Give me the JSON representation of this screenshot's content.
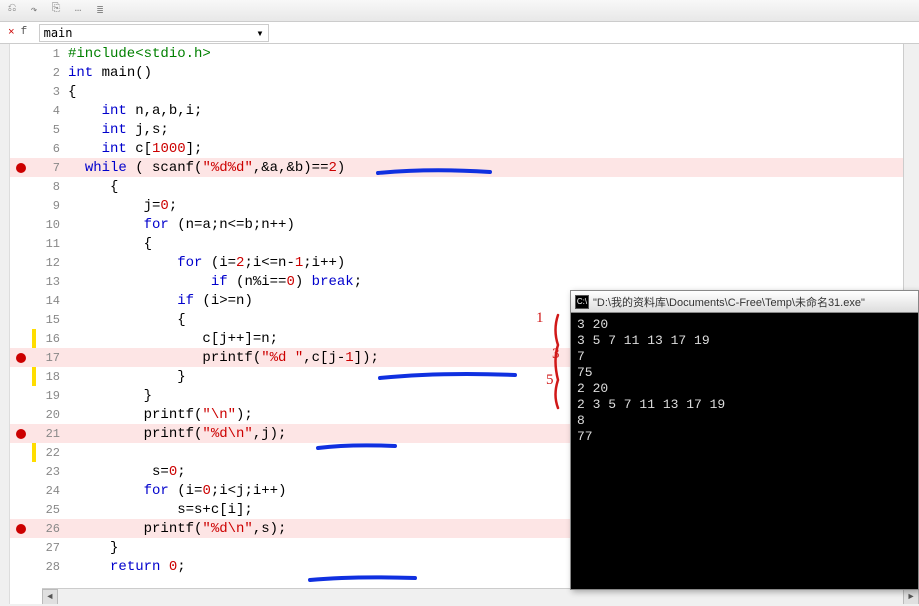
{
  "toolbar": {
    "icons": [
      "⎌",
      "↷",
      "⎘",
      "…",
      "≣"
    ]
  },
  "funcbar": {
    "icon": "f",
    "label": "main",
    "arrow": "▾"
  },
  "close_x": "×",
  "code": [
    {
      "n": 1,
      "bp": false,
      "hl": false,
      "mark": "",
      "html": "<span class='pp'>#include&lt;stdio.h&gt;</span>"
    },
    {
      "n": 2,
      "bp": false,
      "hl": false,
      "mark": "",
      "html": "<span class='type'>int</span> main()"
    },
    {
      "n": 3,
      "bp": false,
      "hl": false,
      "mark": "",
      "html": "{"
    },
    {
      "n": 4,
      "bp": false,
      "hl": false,
      "mark": "",
      "html": "    <span class='type'>int</span> n,a,b,i;"
    },
    {
      "n": 5,
      "bp": false,
      "hl": false,
      "mark": "",
      "html": "    <span class='type'>int</span> j,s;"
    },
    {
      "n": 6,
      "bp": false,
      "hl": false,
      "mark": "",
      "html": "    <span class='type'>int</span> c[<span class='num'>1000</span>];"
    },
    {
      "n": 7,
      "bp": true,
      "hl": true,
      "mark": "",
      "html": "  <span class='kw'>while</span> ( scanf(<span class='str'>\"%d%d\"</span>,&amp;a,&amp;b)==<span class='num'>2</span>)"
    },
    {
      "n": 8,
      "bp": false,
      "hl": false,
      "mark": "",
      "html": "     {"
    },
    {
      "n": 9,
      "bp": false,
      "hl": false,
      "mark": "",
      "html": "         j=<span class='num'>0</span>;"
    },
    {
      "n": 10,
      "bp": false,
      "hl": false,
      "mark": "",
      "html": "         <span class='kw'>for</span> (n=a;n&lt;=b;n++)"
    },
    {
      "n": 11,
      "bp": false,
      "hl": false,
      "mark": "",
      "html": "         {"
    },
    {
      "n": 12,
      "bp": false,
      "hl": false,
      "mark": "",
      "html": "             <span class='kw'>for</span> (i=<span class='num'>2</span>;i&lt;=n-<span class='num'>1</span>;i++)"
    },
    {
      "n": 13,
      "bp": false,
      "hl": false,
      "mark": "",
      "html": "                 <span class='kw'>if</span> (n%i==<span class='num'>0</span>) <span class='kw'>break</span>;"
    },
    {
      "n": 14,
      "bp": false,
      "hl": false,
      "mark": "",
      "html": "             <span class='kw'>if</span> (i&gt;=n)"
    },
    {
      "n": 15,
      "bp": false,
      "hl": false,
      "mark": "",
      "html": "             {"
    },
    {
      "n": 16,
      "bp": false,
      "hl": false,
      "mark": "yellow",
      "html": "                c[j++]=n;"
    },
    {
      "n": 17,
      "bp": true,
      "hl": true,
      "mark": "",
      "html": "                printf(<span class='str'>\"%d \"</span>,c[j-<span class='num'>1</span>]);"
    },
    {
      "n": 18,
      "bp": false,
      "hl": false,
      "mark": "yellow",
      "html": "             }"
    },
    {
      "n": 19,
      "bp": false,
      "hl": false,
      "mark": "",
      "html": "         }"
    },
    {
      "n": 20,
      "bp": false,
      "hl": false,
      "mark": "",
      "html": "         printf(<span class='str'>\"\\n\"</span>);"
    },
    {
      "n": 21,
      "bp": true,
      "hl": true,
      "mark": "",
      "html": "         printf(<span class='str'>\"%d\\n\"</span>,j);"
    },
    {
      "n": 22,
      "bp": false,
      "hl": false,
      "mark": "yellow",
      "html": ""
    },
    {
      "n": 23,
      "bp": false,
      "hl": false,
      "mark": "",
      "html": "          s=<span class='num'>0</span>;"
    },
    {
      "n": 24,
      "bp": false,
      "hl": false,
      "mark": "",
      "html": "         <span class='kw'>for</span> (i=<span class='num'>0</span>;i&lt;j;i++)"
    },
    {
      "n": 25,
      "bp": false,
      "hl": false,
      "mark": "",
      "html": "             s=s+c[i];"
    },
    {
      "n": 26,
      "bp": true,
      "hl": true,
      "mark": "",
      "html": "         printf(<span class='str'>\"%d\\n\"</span>,s);"
    },
    {
      "n": 27,
      "bp": false,
      "hl": false,
      "mark": "",
      "html": "     }"
    },
    {
      "n": 28,
      "bp": false,
      "hl": false,
      "mark": "",
      "html": "     <span class='kw'>return</span> <span class='num'>0</span>;"
    }
  ],
  "console": {
    "title": "\"D:\\我的资料库\\Documents\\C-Free\\Temp\\未命名31.exe\"",
    "lines": [
      "3 20",
      "3 5 7 11 13 17 19",
      "7",
      "75",
      "2 20",
      "2 3 5 7 11 13 17 19",
      "8",
      "77"
    ]
  },
  "scroll": {
    "left": "◄",
    "right": "►"
  }
}
